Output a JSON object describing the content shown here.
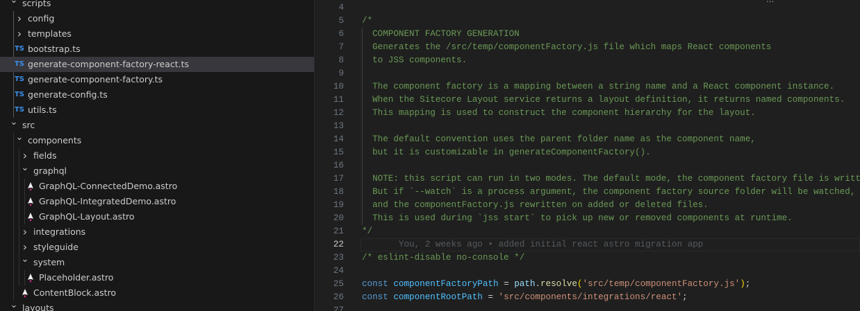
{
  "explorer": {
    "items": [
      {
        "label": "scripts",
        "type": "folder",
        "open": true,
        "depth": 0
      },
      {
        "label": "config",
        "type": "folder",
        "open": false,
        "depth": 1
      },
      {
        "label": "templates",
        "type": "folder",
        "open": false,
        "depth": 1
      },
      {
        "label": "bootstrap.ts",
        "type": "ts",
        "depth": 1
      },
      {
        "label": "generate-component-factory-react.ts",
        "type": "ts",
        "depth": 1,
        "selected": true
      },
      {
        "label": "generate-component-factory.ts",
        "type": "ts",
        "depth": 1
      },
      {
        "label": "generate-config.ts",
        "type": "ts",
        "depth": 1
      },
      {
        "label": "utils.ts",
        "type": "ts",
        "depth": 1
      },
      {
        "label": "src",
        "type": "folder",
        "open": true,
        "depth": 0
      },
      {
        "label": "components",
        "type": "folder",
        "open": true,
        "depth": 1
      },
      {
        "label": "fields",
        "type": "folder",
        "open": false,
        "depth": 2
      },
      {
        "label": "graphql",
        "type": "folder",
        "open": true,
        "depth": 2
      },
      {
        "label": "GraphQL-ConnectedDemo.astro",
        "type": "astro",
        "depth": 3
      },
      {
        "label": "GraphQL-IntegratedDemo.astro",
        "type": "astro",
        "depth": 3
      },
      {
        "label": "GraphQL-Layout.astro",
        "type": "astro",
        "depth": 3
      },
      {
        "label": "integrations",
        "type": "folder",
        "open": false,
        "depth": 2
      },
      {
        "label": "styleguide",
        "type": "folder",
        "open": false,
        "depth": 2
      },
      {
        "label": "system",
        "type": "folder",
        "open": true,
        "depth": 2
      },
      {
        "label": "Placeholder.astro",
        "type": "astro",
        "depth": 3
      },
      {
        "label": "ContentBlock.astro",
        "type": "astro",
        "depth": 2
      },
      {
        "label": "layouts",
        "type": "folder",
        "open": true,
        "depth": 0
      }
    ],
    "ts_icon_text": "TS"
  },
  "editor": {
    "fold_marker": "...",
    "current_line": 22,
    "lines": [
      {
        "n": 4,
        "tokens": []
      },
      {
        "n": 5,
        "tokens": [
          {
            "t": "/*",
            "c": "comment"
          }
        ]
      },
      {
        "n": 6,
        "tokens": [
          {
            "t": "  COMPONENT FACTORY GENERATION",
            "c": "comment"
          }
        ]
      },
      {
        "n": 7,
        "tokens": [
          {
            "t": "  Generates the /src/temp/componentFactory.js file which maps React components",
            "c": "comment"
          }
        ]
      },
      {
        "n": 8,
        "tokens": [
          {
            "t": "  to JSS components.",
            "c": "comment"
          }
        ]
      },
      {
        "n": 9,
        "tokens": []
      },
      {
        "n": 10,
        "tokens": [
          {
            "t": "  The component factory is a mapping between a string name and a React component instance.",
            "c": "comment"
          }
        ]
      },
      {
        "n": 11,
        "tokens": [
          {
            "t": "  When the Sitecore Layout service returns a layout definition, it returns named components.",
            "c": "comment"
          }
        ]
      },
      {
        "n": 12,
        "tokens": [
          {
            "t": "  This mapping is used to construct the component hierarchy for the layout.",
            "c": "comment"
          }
        ]
      },
      {
        "n": 13,
        "tokens": []
      },
      {
        "n": 14,
        "tokens": [
          {
            "t": "  The default convention uses the parent folder name as the component name,",
            "c": "comment"
          }
        ]
      },
      {
        "n": 15,
        "tokens": [
          {
            "t": "  but it is customizable in generateComponentFactory().",
            "c": "comment"
          }
        ]
      },
      {
        "n": 16,
        "tokens": []
      },
      {
        "n": 17,
        "tokens": [
          {
            "t": "  NOTE: this script can run in two modes. The default mode, the component factory file is written",
            "c": "comment"
          }
        ]
      },
      {
        "n": 18,
        "tokens": [
          {
            "t": "  But if `--watch` is a process argument, the component factory source folder will be watched,",
            "c": "comment"
          }
        ]
      },
      {
        "n": 19,
        "tokens": [
          {
            "t": "  and the componentFactory.js rewritten on added or deleted files.",
            "c": "comment"
          }
        ]
      },
      {
        "n": 20,
        "tokens": [
          {
            "t": "  This is used during `jss start` to pick up new or removed components at runtime.",
            "c": "comment"
          }
        ]
      },
      {
        "n": 21,
        "tokens": [
          {
            "t": "*/",
            "c": "comment"
          }
        ]
      },
      {
        "n": 22,
        "tokens": [
          {
            "t": "       You, 2 weeks ago • added initial react astro migration app",
            "c": "blame"
          }
        ]
      },
      {
        "n": 23,
        "tokens": [
          {
            "t": "/* eslint-disable no-console */",
            "c": "comment"
          }
        ]
      },
      {
        "n": 24,
        "tokens": []
      },
      {
        "n": 25,
        "tokens": [
          {
            "t": "const ",
            "c": "kw"
          },
          {
            "t": "componentFactoryPath",
            "c": "var"
          },
          {
            "t": " = ",
            "c": "plain"
          },
          {
            "t": "path",
            "c": "ident"
          },
          {
            "t": ".",
            "c": "plain"
          },
          {
            "t": "resolve",
            "c": "fn"
          },
          {
            "t": "(",
            "c": "brk"
          },
          {
            "t": "'src/temp/componentFactory.js'",
            "c": "str"
          },
          {
            "t": ")",
            "c": "brk"
          },
          {
            "t": ";",
            "c": "plain"
          }
        ]
      },
      {
        "n": 26,
        "tokens": [
          {
            "t": "const ",
            "c": "kw"
          },
          {
            "t": "componentRootPath",
            "c": "var"
          },
          {
            "t": " = ",
            "c": "plain"
          },
          {
            "t": "'src/components/integrations/react'",
            "c": "str"
          },
          {
            "t": ";",
            "c": "plain"
          }
        ]
      },
      {
        "n": 27,
        "tokens": []
      }
    ]
  }
}
